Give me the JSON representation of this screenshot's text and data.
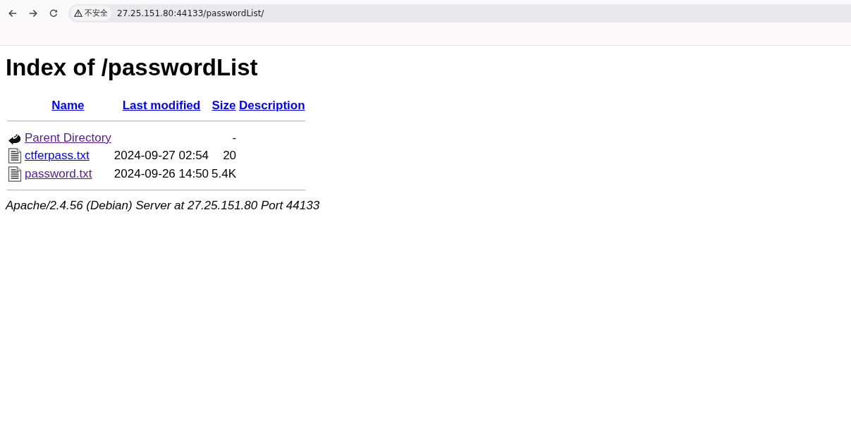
{
  "browser": {
    "security_label": "不安全",
    "url": "27.25.151.80:44133/passwordList/"
  },
  "page": {
    "title": "Index of /passwordList",
    "table": {
      "columns": [
        "Name",
        "Last modified",
        "Size",
        "Description"
      ],
      "rows": [
        {
          "kind": "parent",
          "name": "Parent Directory",
          "visited": true,
          "size": "-"
        },
        {
          "kind": "text",
          "name": "ctferpass.txt",
          "visited": false,
          "last_modified": "2024-09-27 02:54",
          "size": "20"
        },
        {
          "kind": "text",
          "name": "password.txt",
          "visited": true,
          "last_modified": "2024-09-26 14:50",
          "size": "5.4K"
        }
      ]
    },
    "address": "Apache/2.4.56 (Debian) Server at 27.25.151.80 Port 44133"
  }
}
